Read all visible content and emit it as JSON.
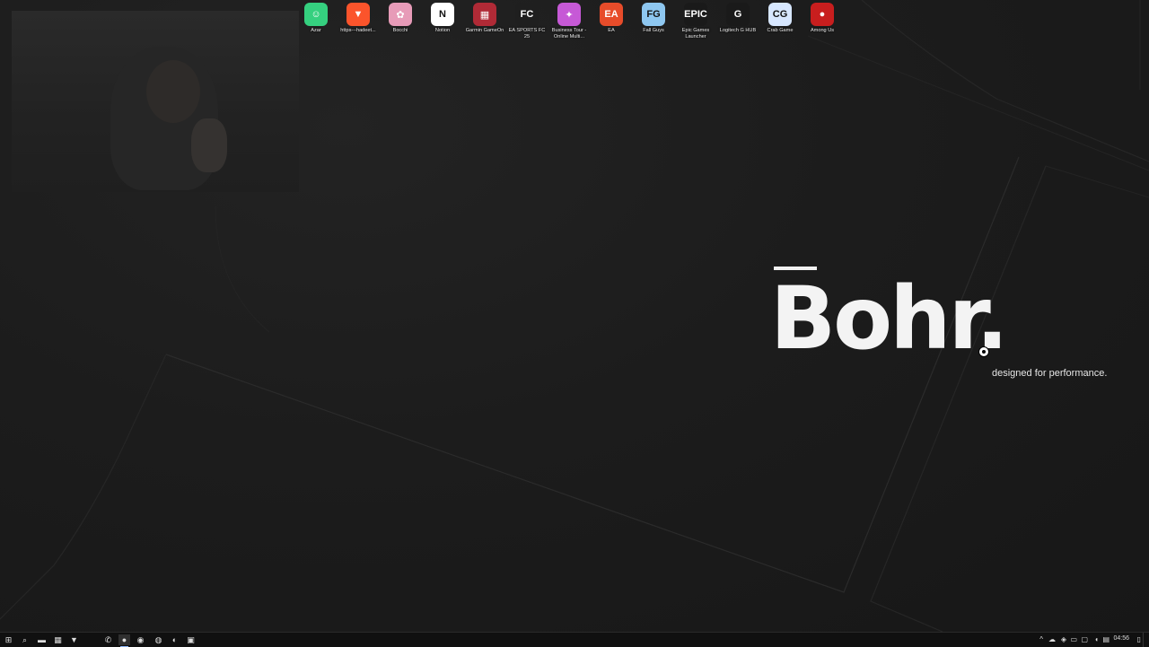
{
  "desktop_icons": [
    {
      "name": "azar",
      "label": "Azar",
      "icon": "azar-icon",
      "color": "#35d07f",
      "glyph": "☺"
    },
    {
      "name": "brave-link",
      "label": "https---hadeet...",
      "icon": "brave-lion-icon",
      "color": "#fb542b",
      "glyph": "▼"
    },
    {
      "name": "bocchi",
      "label": "Bocchi",
      "icon": "anime-character-icon",
      "color": "#e79bb8",
      "glyph": "✿"
    },
    {
      "name": "notion",
      "label": "Notion",
      "icon": "notion-icon",
      "color": "#ffffff",
      "glyph": "N"
    },
    {
      "name": "garmin-gameon",
      "label": "Garmin GameOn",
      "icon": "garmin-gameon-icon",
      "color": "#b02a36",
      "glyph": "▦"
    },
    {
      "name": "ea-sports-fc25",
      "label": "EA SPORTS FC 25",
      "icon": "ea-fc25-icon",
      "color": "#1f1f1f",
      "glyph": "FC"
    },
    {
      "name": "business-tour",
      "label": "Business Tour - Online Multi...",
      "icon": "business-tour-icon",
      "color": "#c659d6",
      "glyph": "✦"
    },
    {
      "name": "ea",
      "label": "EA",
      "icon": "ea-icon",
      "color": "#e74c2a",
      "glyph": "EA"
    },
    {
      "name": "fall-guys",
      "label": "Fall Guys",
      "icon": "fall-guys-icon",
      "color": "#8ec7f0",
      "glyph": "FG"
    },
    {
      "name": "epic-games",
      "label": "Epic Games Launcher",
      "icon": "epic-games-icon",
      "color": "#1a1a1a",
      "glyph": "EPIC"
    },
    {
      "name": "logitech-g-hub",
      "label": "Logitech G HUB",
      "icon": "logitech-g-icon",
      "color": "#1a1a1a",
      "glyph": "G"
    },
    {
      "name": "crab-game",
      "label": "Crab Game",
      "icon": "crab-game-icon",
      "color": "#d7e7ff",
      "glyph": "CG"
    },
    {
      "name": "among-us",
      "label": "Among Us",
      "icon": "among-us-icon",
      "color": "#c81e1e",
      "glyph": "●"
    }
  ],
  "wallpaper": {
    "brand": "Bohr.",
    "tagline": "designed for performance."
  },
  "taskbar": {
    "apps": [
      {
        "name": "start",
        "icon": "windows-start-icon",
        "glyph": "⊞",
        "active": false
      },
      {
        "name": "search",
        "icon": "search-icon",
        "glyph": "⌕",
        "active": false
      },
      {
        "name": "file-explorer",
        "icon": "folder-icon",
        "glyph": "▬",
        "active": false
      },
      {
        "name": "calculator",
        "icon": "calculator-icon",
        "glyph": "▦",
        "active": false
      },
      {
        "name": "brave",
        "icon": "brave-lion-icon",
        "glyph": "▼",
        "active": false
      },
      {
        "name": "whatsapp",
        "icon": "whatsapp-icon",
        "glyph": "✆",
        "active": false
      },
      {
        "name": "spotify",
        "icon": "spotify-icon",
        "glyph": "●",
        "active": true
      },
      {
        "name": "recorder",
        "icon": "recorder-icon",
        "glyph": "◉",
        "active": false
      },
      {
        "name": "steam",
        "icon": "steam-icon",
        "glyph": "◍",
        "active": false
      },
      {
        "name": "discord",
        "icon": "discord-icon",
        "glyph": "◐",
        "active": false
      },
      {
        "name": "red-app",
        "icon": "red-app-icon",
        "glyph": "▣",
        "active": false
      }
    ],
    "tray": {
      "clock": "04:56",
      "icons": [
        "chevron-up-icon",
        "onedrive-icon",
        "network-icon",
        "volume-icon",
        "battery-icon",
        "notifications-icon"
      ]
    }
  },
  "colors": {
    "taskbar_active_indicator": "#8ab4f8",
    "brand_text": "#f3f3f3"
  }
}
